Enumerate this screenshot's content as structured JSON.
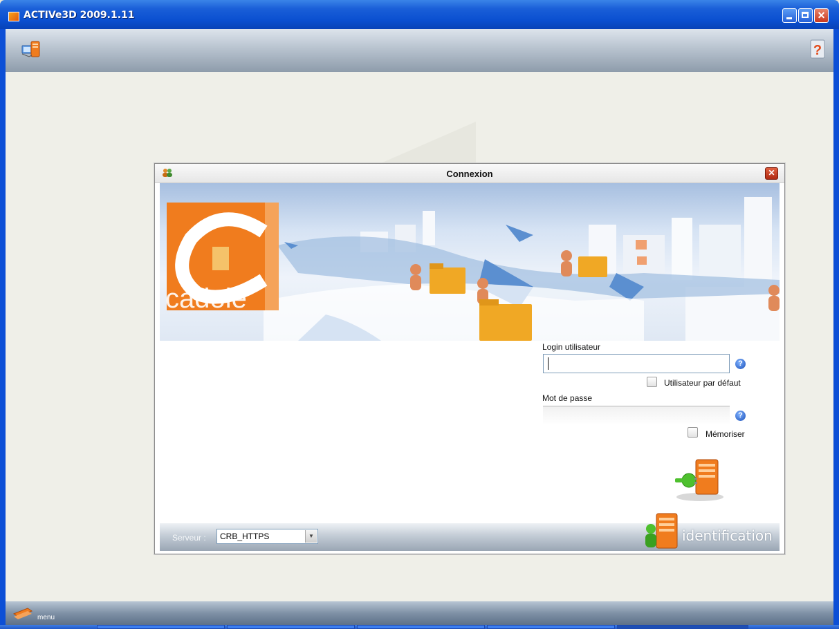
{
  "window": {
    "title": "ACTIVe3D 2009.1.11"
  },
  "dialog": {
    "title": "Connexion",
    "logo_text": "cadole",
    "login": {
      "label": "Login utilisateur",
      "value": "",
      "default_user_label": "Utilisateur par défaut",
      "default_user_checked": false
    },
    "password": {
      "label": "Mot de passe",
      "value": "",
      "remember_label": "Mémoriser",
      "remember_checked": false
    },
    "server": {
      "label": "Serveur :",
      "selected": "CRB_HTTPS"
    },
    "footer_brand": "identification"
  },
  "bottombar": {
    "menu_label": "menu"
  },
  "colors": {
    "accent_orange": "#f07c1e",
    "titlebar_blue": "#0a4fd0",
    "help_blue": "#1a4fb8"
  }
}
